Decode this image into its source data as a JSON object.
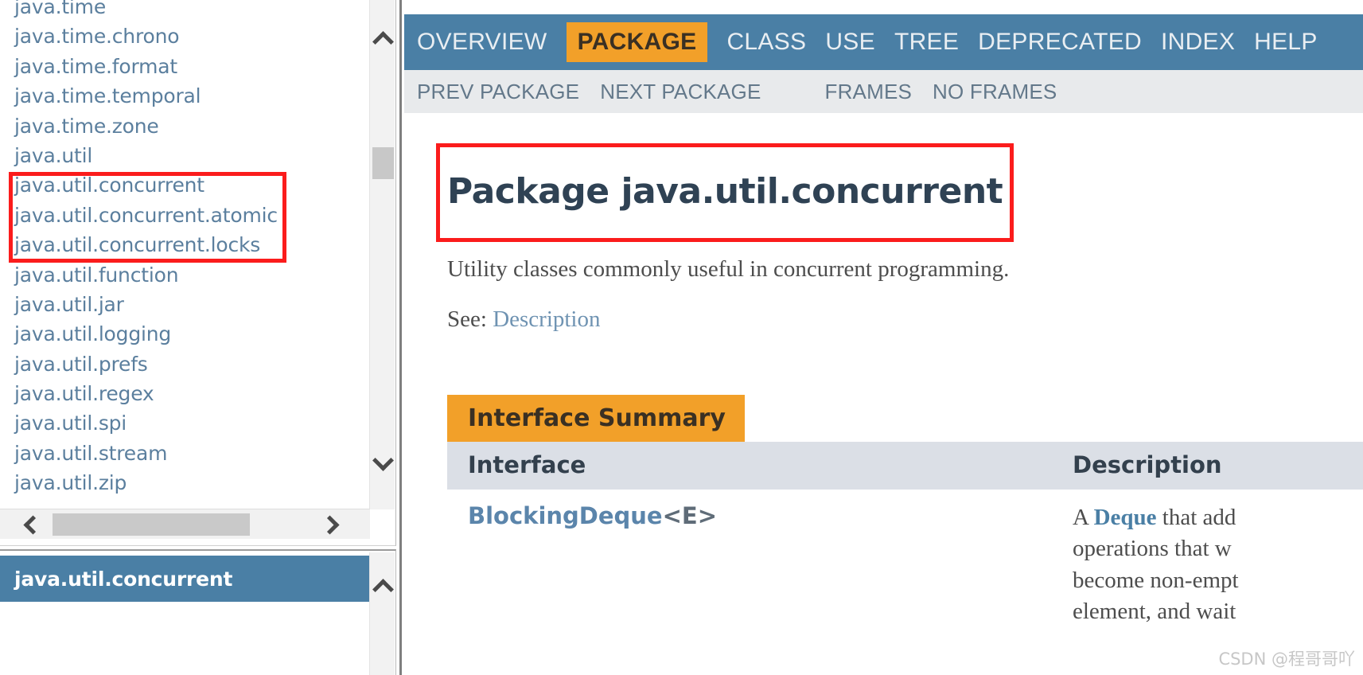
{
  "sidebar": {
    "packages": [
      "java.time",
      "java.time.chrono",
      "java.time.format",
      "java.time.temporal",
      "java.time.zone",
      "java.util",
      "java.util.concurrent",
      "java.util.concurrent.atomic",
      "java.util.concurrent.locks",
      "java.util.function",
      "java.util.jar",
      "java.util.logging",
      "java.util.prefs",
      "java.util.regex",
      "java.util.spi",
      "java.util.stream",
      "java.util.zip"
    ],
    "selected_package": "java.util.concurrent",
    "highlight_color": "#fb1c1c",
    "selected_bg": "#4a7fa5"
  },
  "topnav": {
    "items": [
      {
        "label": "OVERVIEW",
        "active": false
      },
      {
        "label": "PACKAGE",
        "active": true
      },
      {
        "label": "CLASS",
        "active": false
      },
      {
        "label": "USE",
        "active": false
      },
      {
        "label": "TREE",
        "active": false
      },
      {
        "label": "DEPRECATED",
        "active": false
      },
      {
        "label": "INDEX",
        "active": false
      },
      {
        "label": "HELP",
        "active": false
      }
    ],
    "bg_color": "#4a7fa5",
    "active_color": "#f2a029"
  },
  "subnav": {
    "prev_package": "PREV PACKAGE",
    "next_package": "NEXT PACKAGE",
    "frames": "FRAMES",
    "no_frames": "NO FRAMES"
  },
  "main": {
    "title": "Package java.util.concurrent",
    "description": "Utility classes commonly useful in concurrent programming.",
    "see_label": "See",
    "see_separator": ":",
    "see_link": "Description",
    "summary": {
      "caption": "Interface Summary",
      "columns": [
        "Interface",
        "Description"
      ],
      "rows": [
        {
          "interface_name": "BlockingDeque",
          "interface_generic": "<E>",
          "description_lead": "A ",
          "description_bold": "Deque",
          "description_rest": " that add",
          "description_lines": [
            "operations that w",
            "become non-empt",
            "element, and wait"
          ]
        }
      ]
    }
  },
  "watermark": "CSDN @程哥哥吖"
}
